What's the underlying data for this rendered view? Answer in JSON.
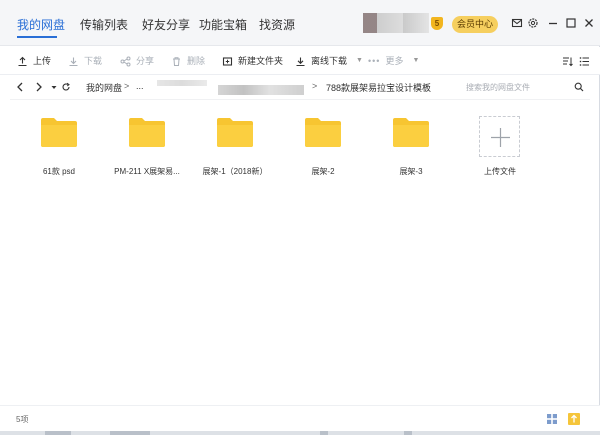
{
  "nav": {
    "tabs": [
      {
        "label": "我的网盘",
        "active": true
      },
      {
        "label": "传输列表",
        "active": false
      },
      {
        "label": "好友分享",
        "active": false
      },
      {
        "label": "功能宝箱",
        "active": false
      },
      {
        "label": "找资源",
        "active": false
      }
    ],
    "level_badge": "5",
    "vip_button": "会员中心",
    "icons": [
      "mail-icon",
      "settings-icon",
      "minimize-icon",
      "maximize-icon",
      "close-icon"
    ]
  },
  "toolbar": {
    "upload": "上传",
    "download": "下载",
    "share": "分享",
    "delete": "删除",
    "new_folder": "新建文件夹",
    "offline_download": "离线下载",
    "more": "更多"
  },
  "address": {
    "root": "我的网盘",
    "ellipsis": "...",
    "current": "788款展架易拉宝设计模板",
    "search_placeholder": "搜索我的网盘文件"
  },
  "files": [
    {
      "name": "61款 psd",
      "icon": "folder-icon"
    },
    {
      "name": "PM-211 X展架易...",
      "icon": "folder-icon"
    },
    {
      "name": "展架-1（2018新）",
      "icon": "folder-icon"
    },
    {
      "name": "展架-2",
      "icon": "folder-icon"
    },
    {
      "name": "展架-3",
      "icon": "folder-icon"
    }
  ],
  "upload_tile": {
    "label": "上传文件"
  },
  "status": {
    "count": "5项"
  },
  "colors": {
    "accent": "#2a6fd6",
    "folder": "#f7c531",
    "vip": "#f6cf5f"
  }
}
